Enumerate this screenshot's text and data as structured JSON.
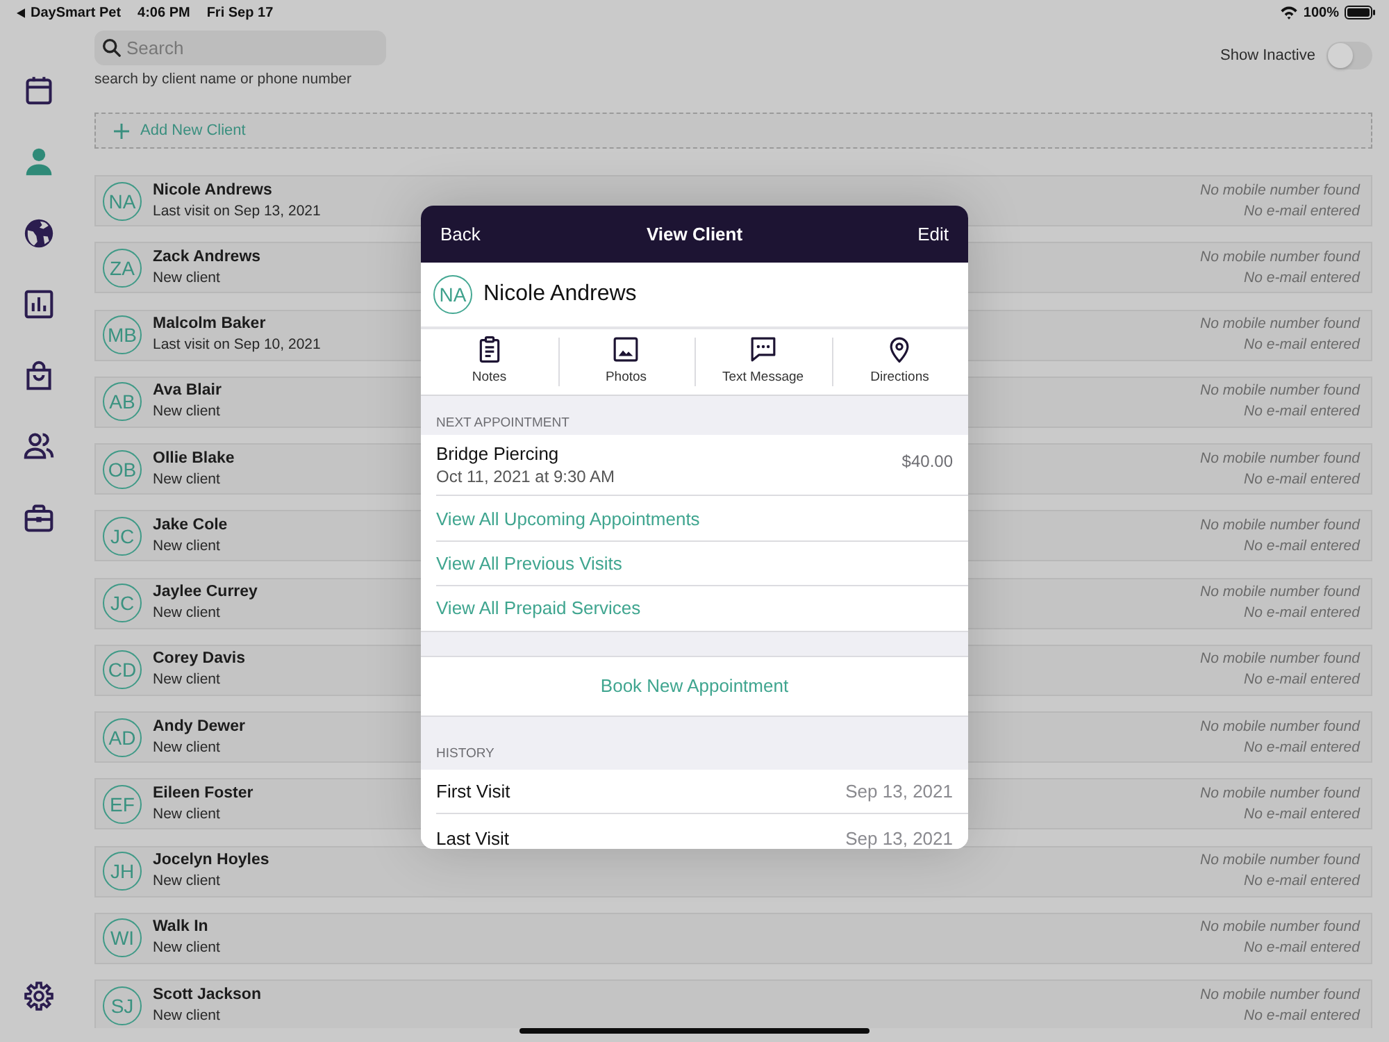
{
  "status_bar": {
    "back_app": "DaySmart Pet",
    "time": "4:06 PM",
    "date": "Fri Sep 17",
    "battery": "100%"
  },
  "sidebar": {
    "items": [
      {
        "kind": "calendar",
        "selected": false
      },
      {
        "kind": "person",
        "selected": true
      },
      {
        "kind": "globe",
        "selected": false
      },
      {
        "kind": "chart",
        "selected": false
      },
      {
        "kind": "bag",
        "selected": false
      },
      {
        "kind": "people",
        "selected": false
      },
      {
        "kind": "briefcase",
        "selected": false
      }
    ],
    "footer_items": [
      {
        "kind": "gear",
        "selected": false
      }
    ]
  },
  "search": {
    "placeholder": "Search",
    "hint": "search by client name or phone number"
  },
  "show_inactive": {
    "label": "Show Inactive",
    "on": false
  },
  "add_client": {
    "label": "Add New Client"
  },
  "clients": [
    {
      "initials": "NA",
      "name": "Nicole Andrews",
      "subtitle": "Last visit on Sep 13, 2021",
      "phone": "No mobile number found",
      "email": "No e-mail entered"
    },
    {
      "initials": "ZA",
      "name": "Zack Andrews",
      "subtitle": "New client",
      "phone": "No mobile number found",
      "email": "No e-mail entered"
    },
    {
      "initials": "MB",
      "name": "Malcolm Baker",
      "subtitle": "Last visit on Sep 10, 2021",
      "phone": "No mobile number found",
      "email": "No e-mail entered"
    },
    {
      "initials": "AB",
      "name": "Ava Blair",
      "subtitle": "New client",
      "phone": "No mobile number found",
      "email": "No e-mail entered"
    },
    {
      "initials": "OB",
      "name": "Ollie Blake",
      "subtitle": "New client",
      "phone": "No mobile number found",
      "email": "No e-mail entered"
    },
    {
      "initials": "JC",
      "name": "Jake Cole",
      "subtitle": "New client",
      "phone": "No mobile number found",
      "email": "No e-mail entered"
    },
    {
      "initials": "JC",
      "name": "Jaylee Currey",
      "subtitle": "New client",
      "phone": "No mobile number found",
      "email": "No e-mail entered"
    },
    {
      "initials": "CD",
      "name": "Corey Davis",
      "subtitle": "New client",
      "phone": "No mobile number found",
      "email": "No e-mail entered"
    },
    {
      "initials": "AD",
      "name": "Andy Dewer",
      "subtitle": "New client",
      "phone": "No mobile number found",
      "email": "No e-mail entered"
    },
    {
      "initials": "EF",
      "name": "Eileen Foster",
      "subtitle": "New client",
      "phone": "No mobile number found",
      "email": "No e-mail entered"
    },
    {
      "initials": "JH",
      "name": "Jocelyn Hoyles",
      "subtitle": "New client",
      "phone": "No mobile number found",
      "email": "No e-mail entered"
    },
    {
      "initials": "WI",
      "name": "Walk In",
      "subtitle": "New client",
      "phone": "No mobile number found",
      "email": "No e-mail entered"
    },
    {
      "initials": "SJ",
      "name": "Scott Jackson",
      "subtitle": "New client",
      "phone": "No mobile number found",
      "email": "No e-mail entered"
    }
  ],
  "dialog": {
    "back": "Back",
    "title": "View Client",
    "edit": "Edit",
    "client": {
      "initials": "NA",
      "name": "Nicole Andrews"
    },
    "actions": [
      {
        "kind": "notes",
        "label": "Notes"
      },
      {
        "kind": "photos",
        "label": "Photos"
      },
      {
        "kind": "message",
        "label": "Text Message"
      },
      {
        "kind": "directions",
        "label": "Directions"
      }
    ],
    "next_appointment": {
      "heading": "NEXT APPOINTMENT",
      "service": "Bridge Piercing",
      "when": "Oct 11, 2021 at 9:30 AM",
      "price": "$40.00"
    },
    "links": [
      "View All Upcoming Appointments",
      "View All Previous Visits",
      "View All Prepaid Services"
    ],
    "book": "Book New Appointment",
    "history": {
      "heading": "HISTORY",
      "rows": [
        {
          "label": "First Visit",
          "date": "Sep 13, 2021"
        },
        {
          "label": "Last Visit",
          "date": "Sep 13, 2021"
        }
      ]
    }
  }
}
